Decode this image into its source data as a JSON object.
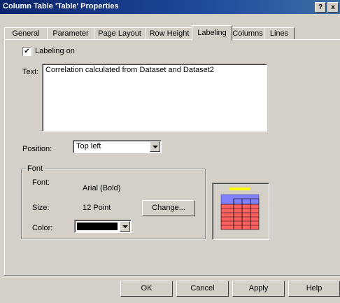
{
  "window": {
    "title": "Column Table 'Table' Properties",
    "help_btn": "?",
    "close_btn": "x"
  },
  "tabs": [
    {
      "label": "General"
    },
    {
      "label": "Parameter"
    },
    {
      "label": "Page Layout"
    },
    {
      "label": "Row Height"
    },
    {
      "label": "Labeling",
      "active": true
    },
    {
      "label": "Columns"
    },
    {
      "label": "Lines"
    }
  ],
  "labeling": {
    "checkbox_label": "Labeling on",
    "checked": true,
    "text_label": "Text:",
    "text_value": "Correlation calculated from Dataset and Dataset2",
    "position_label": "Position:",
    "position_value": "Top left"
  },
  "font_group": {
    "title": "Font",
    "font_label": "Font:",
    "font_value": "Arial (Bold)",
    "size_label": "Size:",
    "size_value": "12 Point",
    "change_button": "Change...",
    "color_label": "Color:",
    "color_value": "#000000"
  },
  "preview": {
    "title_bar_color": "#ffff00",
    "header_color": "#8080ff",
    "cell_color": "#ff6060"
  },
  "buttons": {
    "ok": "OK",
    "cancel": "Cancel",
    "apply": "Apply",
    "help": "Help"
  }
}
